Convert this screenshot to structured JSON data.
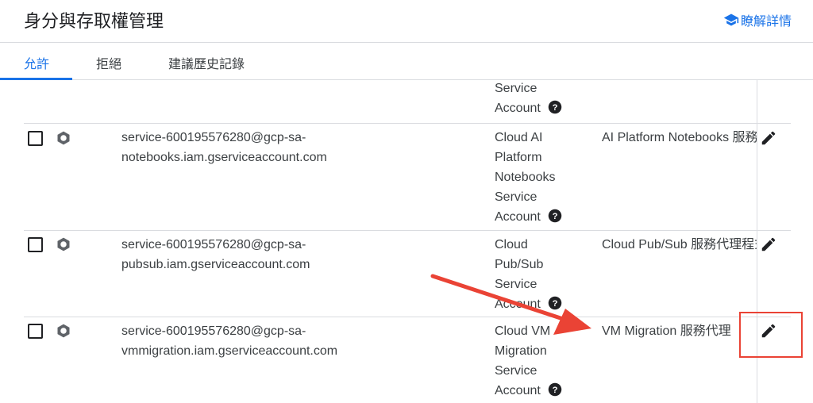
{
  "header": {
    "title": "身分與存取權管理",
    "learn_more": "瞭解詳情",
    "learn_more_icon": "school-icon"
  },
  "tabs": [
    {
      "label": "允許",
      "active": true
    },
    {
      "label": "拒絕",
      "active": false
    },
    {
      "label": "建議歷史記錄",
      "active": false
    }
  ],
  "rows": [
    {
      "email_lines": [],
      "name_lines": [
        "Service",
        "Account"
      ],
      "role": ""
    },
    {
      "email_lines": [
        "service-600195576280@gcp-sa-",
        "notebooks.iam.gserviceaccount.com"
      ],
      "name_lines": [
        "Cloud AI",
        "Platform",
        "Notebooks",
        "Service",
        "Account"
      ],
      "role": "AI Platform Notebooks 服務代理"
    },
    {
      "email_lines": [
        "service-600195576280@gcp-sa-",
        "pubsub.iam.gserviceaccount.com"
      ],
      "name_lines": [
        "Cloud",
        "Pub/Sub",
        "Service",
        "Account"
      ],
      "role": "Cloud Pub/Sub 服務代理程式"
    },
    {
      "email_lines": [
        "service-600195576280@gcp-sa-",
        "vmmigration.iam.gserviceaccount.com"
      ],
      "name_lines": [
        "Cloud VM",
        "Migration",
        "Service",
        "Account"
      ],
      "role": "VM Migration 服務代理"
    }
  ],
  "colors": {
    "accent": "#1a73e8",
    "annotation": "#ea4335"
  }
}
